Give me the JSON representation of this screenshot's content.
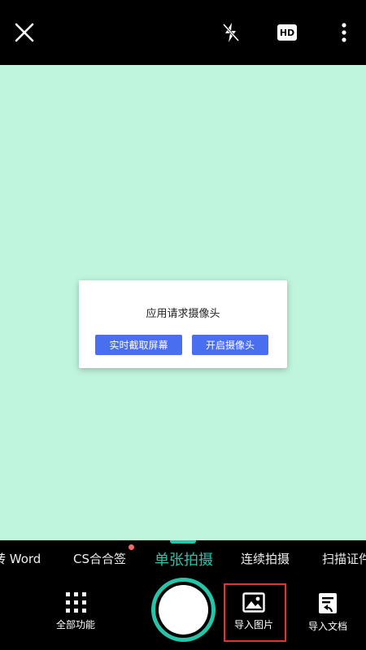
{
  "topbar": {
    "close_icon": "close-icon",
    "flash_icon": "flash-off-icon",
    "hd_label": "HD",
    "more_icon": "more-vertical-icon"
  },
  "dialog": {
    "title": "应用请求摄像头",
    "btn_screen": "实时截取屏幕",
    "btn_camera": "开启摄像头"
  },
  "modes": {
    "items": [
      "转 Word",
      "CS合合签",
      "单张拍摄",
      "连续拍摄",
      "扫描证件"
    ],
    "active_index": 2
  },
  "bottom": {
    "all_features": "全部功能",
    "import_image": "导入图片",
    "import_doc": "导入文档"
  },
  "colors": {
    "accent": "#27c4a8",
    "preview_bg": "#bff5dc",
    "dialog_button": "#4a6ef0",
    "highlight": "#e8312f"
  }
}
